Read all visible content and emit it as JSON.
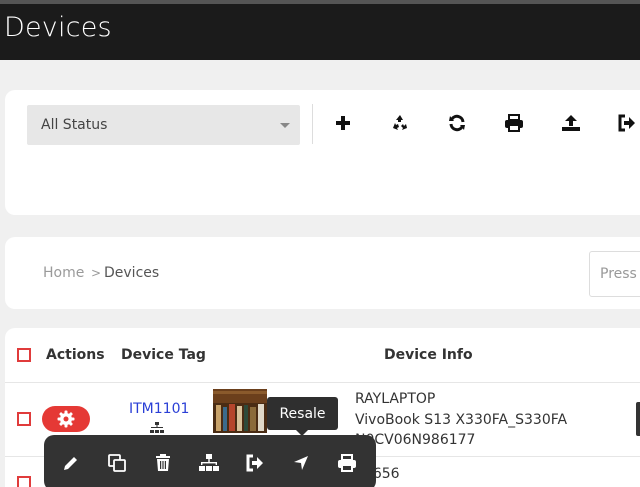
{
  "header": {
    "title": "Devices"
  },
  "filter": {
    "status_value": "All Status"
  },
  "toolbar": {
    "buttons": [
      "plus-icon",
      "recycle-icon",
      "refresh-icon",
      "print-icon",
      "upload-icon",
      "sign-out-icon"
    ]
  },
  "breadcrumb": {
    "home": "Home",
    "separator": ">",
    "current": "Devices"
  },
  "search": {
    "placeholder": "Press"
  },
  "table": {
    "headers": {
      "actions": "Actions",
      "device_tag": "Device Tag",
      "device_info": "Device Info"
    },
    "rows": [
      {
        "device_tag": "ITM1101",
        "info_line1": "RAYLAPTOP",
        "info_line2": "VivoBook S13 X330FA_S330FA",
        "info_line3": "N0CV06N986177"
      },
      {
        "info_line1": "77656"
      }
    ]
  },
  "tooltip": {
    "text": "Resale"
  },
  "action_bar": {
    "buttons": [
      "edit-icon",
      "copy-icon",
      "delete-icon",
      "hierarchy-icon",
      "checkout-icon",
      "navigate-icon",
      "print-icon"
    ]
  },
  "colors": {
    "header_bg": "#1b1b1b",
    "accent_red": "#e53935",
    "link_blue": "#2a3fd6",
    "action_bar_bg": "#333333"
  }
}
